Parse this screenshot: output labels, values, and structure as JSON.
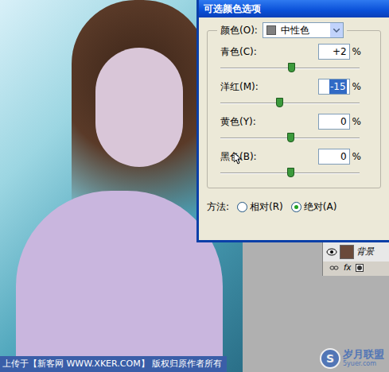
{
  "photo": {
    "caption": "上传于【新客网 WWW.XKER.COM】 版权归原作者所有"
  },
  "dialog": {
    "title": "可选颜色选项",
    "color_label": "颜色(O):",
    "color_value": "中性色",
    "sliders": [
      {
        "label": "青色(C):",
        "value": "+2",
        "unit": "%",
        "level": 0.51,
        "focused": false
      },
      {
        "label": "洋红(M):",
        "value": "-15",
        "unit": "%",
        "level": 0.425,
        "focused": true
      },
      {
        "label": "黄色(Y):",
        "value": "0",
        "unit": "%",
        "level": 0.5,
        "focused": false
      },
      {
        "label": "黑色(B):",
        "value": "0",
        "unit": "%",
        "level": 0.5,
        "focused": false
      }
    ],
    "method_label": "方法:",
    "methods": [
      {
        "label": "相对(R)",
        "selected": false
      },
      {
        "label": "绝对(A)",
        "selected": true
      }
    ]
  },
  "layers_panel": {
    "layer_name": "背景",
    "visible": true,
    "fx_label": "fx"
  },
  "watermark": {
    "logo_letter": "S",
    "text": "岁月联盟",
    "url": "5yuer.com"
  }
}
